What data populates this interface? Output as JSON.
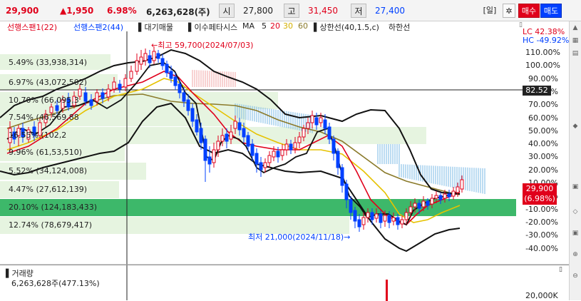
{
  "header": {
    "price": "29,900",
    "change": "▲1,950",
    "change_pct": "6.98%",
    "volume": "6,263,628(주)",
    "open_label": "시",
    "open_value": "27,800",
    "high_label": "고",
    "high_value": "31,450",
    "low_label": "저",
    "low_value": "27,400",
    "period_label": "[일]",
    "buy_label": "매수",
    "sell_label": "매도"
  },
  "legend": {
    "items": [
      {
        "text": "선행스팬1(22)",
        "color": "#e0001b"
      },
      {
        "text": "선행스팬2(44)",
        "color": "#0040ff"
      },
      {
        "text": "▌대기매물",
        "color": "#222222"
      },
      {
        "text": "▌이수페타시스",
        "color": "#222222"
      },
      {
        "text": "MA",
        "color": "#222222"
      },
      {
        "text": "5",
        "color": "#222222"
      },
      {
        "text": "20",
        "color": "#e0001b"
      },
      {
        "text": "30",
        "color": "#d4b000"
      },
      {
        "text": "60",
        "color": "#8a7a2a"
      },
      {
        "text": "▌상한선(40,1.5,c)",
        "color": "#222222"
      },
      {
        "text": "하한선",
        "color": "#222222"
      }
    ],
    "lc": "LC 42.38%",
    "hc": "HC -49.92%"
  },
  "volume_profile": [
    {
      "label": "5.49% (33,938,314)",
      "highlight": false
    },
    {
      "label": "6.97% (43,072,502)",
      "highlight": false
    },
    {
      "label": "10.70% (66,095,3",
      "highlight": false
    },
    {
      "label": "7.54% (46,569,88",
      "highlight": false
    },
    {
      "label": "16.55% (102,2",
      "highlight": false
    },
    {
      "label": "9.96% (61,53,510)",
      "highlight": false
    },
    {
      "label": "5.52% (34,124,008)",
      "highlight": false
    },
    {
      "label": "4.47% (27,612,139)",
      "highlight": false
    },
    {
      "label": "20.10% (124,183,433)",
      "highlight": true
    },
    {
      "label": "12.74% (78,679,417)",
      "highlight": false
    }
  ],
  "y_axis": [
    "110.00%",
    "100.00%",
    "90.00%",
    "80.00%",
    "70.00%",
    "60.00%",
    "50.00%",
    "40.00%",
    "30.00%",
    "20.00%",
    "10.00%",
    "0.00%",
    "-10.00%",
    "-20.00%",
    "-30.00%",
    "-40.00%"
  ],
  "annotations": {
    "high": "최고 59,700(2024/07/03)",
    "low": "최저 21,000(2024/11/18)",
    "crosshair_value": "82.52",
    "current_price": "29,900",
    "current_pct": "(6.98%)"
  },
  "volume_pane": {
    "title": "거래량",
    "value": "6,263,628주(477.13%)",
    "axis_label": "20,000K"
  },
  "colors": {
    "up": "#e0001b",
    "down": "#0040ff",
    "profile_fill": "#e6f4e0",
    "profile_highlight": "#3db86a",
    "ichimoku_red": "#f2a0a0",
    "ichimoku_blue": "#6ab0e0"
  }
}
